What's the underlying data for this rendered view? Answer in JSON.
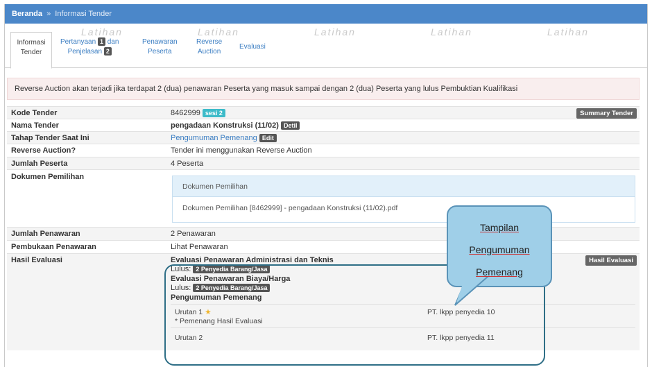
{
  "breadcrumb": {
    "home": "Beranda",
    "separator": "»",
    "current": "Informasi Tender"
  },
  "watermark": "Latihan",
  "tabs": [
    {
      "line1": "Informasi",
      "line2": "Tender"
    },
    {
      "line1a": "Pertanyaan",
      "badge": "1",
      "line1b": "dan",
      "line2": "Penjelasan",
      "badge2": "2"
    },
    {
      "line1": "Penawaran",
      "line2": "Peserta"
    },
    {
      "line1": "Reverse",
      "line2": "Auction"
    },
    {
      "line1": "Evaluasi"
    }
  ],
  "alert": "Reverse Auction akan terjadi jika terdapat 2 (dua) penawaran Peserta yang masuk sampai dengan 2 (dua) Peserta yang lulus Pembuktian Kualifikasi",
  "info": {
    "kode_label": "Kode Tender",
    "kode_value": "8462999",
    "sesi": "sesi 2",
    "summary_btn": "Summary Tender",
    "nama_label": "Nama Tender",
    "nama_value": "pengadaan Konstruksi (11/02)",
    "detil_btn": "Detil",
    "tahap_label": "Tahap Tender Saat Ini",
    "tahap_value": "Pengumuman Pemenang",
    "edit_btn": "Edit",
    "reverse_label": "Reverse Auction?",
    "reverse_value": "Tender ini menggunakan Reverse Auction",
    "peserta_label": "Jumlah Peserta",
    "peserta_value": "4 Peserta",
    "dokumen_label": "Dokumen Pemilihan",
    "dokumen_head": "Dokumen Pemilihan",
    "dokumen_file": "Dokumen Pemilihan [8462999] - pengadaan Konstruksi (11/02).pdf",
    "penawaran_label": "Jumlah Penawaran",
    "penawaran_value": "2 Penawaran",
    "pembukaan_label": "Pembukaan Penawaran",
    "pembukaan_link": "Lihat Penawaran",
    "hasil_label": "Hasil Evaluasi",
    "hasil_btn": "Hasil Evaluasi"
  },
  "evaluasi": {
    "admin_title": "Evaluasi Penawaran Administrasi dan Teknis",
    "lulus_label": "Lulus:",
    "admin_lulus": "2 Penyedia Barang/Jasa",
    "biaya_title": "Evaluasi Penawaran Biaya/Harga",
    "biaya_lulus": "2 Penyedia Barang/Jasa",
    "pengumuman_title": "Pengumuman Pemenang",
    "rank1": "Urutan 1",
    "rank1_note": "* Pemenang Hasil Evaluasi",
    "rank1_name": "PT. lkpp penyedia 10",
    "rank2": "Urutan 2",
    "rank2_name": "PT. lkpp penyedia 11"
  },
  "callout": {
    "line1": "Tampilan",
    "line2": "Pengumuman",
    "line3": "Pemenang"
  }
}
